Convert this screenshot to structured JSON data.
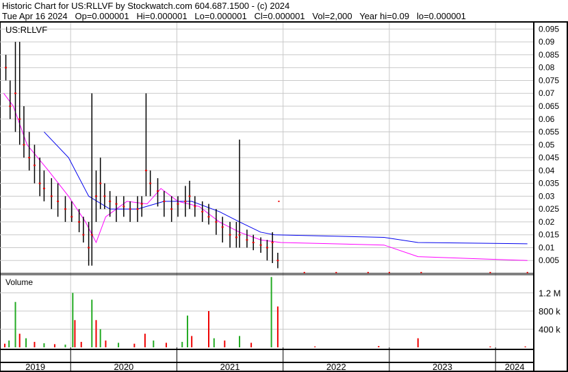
{
  "header": {
    "title": "Historic Chart for US:RLLVF by Stockwatch.com 604.687.1500 - (c) 2024",
    "quote": "Tue Apr 16 2024   Op=0.000001   Hi=0.000001   Lo=0.000001   Cl=0.000001   Vol=2,000   Year hi=0.09   lo=0.000001"
  },
  "price_panel_label": "US:RLLVF",
  "volume_panel_label": "Volume",
  "colors": {
    "up": "#22aa22",
    "down": "#ee0000",
    "ma_long": "#0000ee",
    "ma_short": "#ff00ff",
    "grid": "#c8c8c8"
  },
  "chart_data": {
    "type": "bar",
    "title": "Historic Chart for US:RLLVF",
    "x_range": [
      2019.335,
      2024.36
    ],
    "x_tick_labels": [
      "2019",
      "2020",
      "2021",
      "2022",
      "2023",
      "2024"
    ],
    "year_starts": [
      2020,
      2021,
      2022,
      2023,
      2024
    ],
    "price_ylim": [
      0,
      0.0975
    ],
    "price_ticks": [
      "0.005",
      "0.01",
      "0.015",
      "0.02",
      "0.025",
      "0.03",
      "0.035",
      "0.04",
      "0.045",
      "0.05",
      "0.055",
      "0.06",
      "0.065",
      "0.07",
      "0.075",
      "0.08",
      "0.085",
      "0.09",
      "0.095"
    ],
    "volume_ylim": [
      0,
      1600000
    ],
    "volume_ticks": [
      {
        "v": 400000,
        "label": "400 k"
      },
      {
        "v": 800000,
        "label": "800 k"
      },
      {
        "v": 1200000,
        "label": "1.2 M"
      }
    ],
    "price_bars": [
      {
        "t": 2019.39,
        "h": 0.085,
        "l": 0.075,
        "c": 0.08
      },
      {
        "t": 2019.43,
        "h": 0.075,
        "l": 0.06,
        "c": 0.065
      },
      {
        "t": 2019.48,
        "h": 0.09,
        "l": 0.055,
        "c": 0.07
      },
      {
        "t": 2019.52,
        "h": 0.09,
        "l": 0.05,
        "c": 0.06
      },
      {
        "t": 2019.56,
        "h": 0.065,
        "l": 0.045,
        "c": 0.05
      },
      {
        "t": 2019.61,
        "h": 0.055,
        "l": 0.04,
        "c": 0.045
      },
      {
        "t": 2019.66,
        "h": 0.05,
        "l": 0.035,
        "c": 0.042
      },
      {
        "t": 2019.71,
        "h": 0.045,
        "l": 0.03,
        "c": 0.035
      },
      {
        "t": 2019.75,
        "h": 0.04,
        "l": 0.028,
        "c": 0.033
      },
      {
        "t": 2019.82,
        "h": 0.037,
        "l": 0.025,
        "c": 0.03
      },
      {
        "t": 2019.88,
        "h": 0.035,
        "l": 0.022,
        "c": 0.028
      },
      {
        "t": 2019.95,
        "h": 0.03,
        "l": 0.02,
        "c": 0.025
      },
      {
        "t": 2020.01,
        "h": 0.028,
        "l": 0.02,
        "c": 0.022
      },
      {
        "t": 2020.08,
        "h": 0.025,
        "l": 0.016,
        "c": 0.02
      },
      {
        "t": 2020.12,
        "h": 0.022,
        "l": 0.012,
        "c": 0.015
      },
      {
        "t": 2020.17,
        "h": 0.02,
        "l": 0.003,
        "c": 0.01
      },
      {
        "t": 2020.2,
        "h": 0.07,
        "l": 0.003,
        "c": 0.015
      },
      {
        "t": 2020.24,
        "h": 0.04,
        "l": 0.02,
        "c": 0.03
      },
      {
        "t": 2020.28,
        "h": 0.045,
        "l": 0.025,
        "c": 0.035
      },
      {
        "t": 2020.32,
        "h": 0.035,
        "l": 0.025,
        "c": 0.03
      },
      {
        "t": 2020.37,
        "h": 0.032,
        "l": 0.022,
        "c": 0.028
      },
      {
        "t": 2020.43,
        "h": 0.03,
        "l": 0.02,
        "c": 0.027
      },
      {
        "t": 2020.5,
        "h": 0.03,
        "l": 0.022,
        "c": 0.026
      },
      {
        "t": 2020.56,
        "h": 0.028,
        "l": 0.02,
        "c": 0.025
      },
      {
        "t": 2020.63,
        "h": 0.03,
        "l": 0.02,
        "c": 0.025
      },
      {
        "t": 2020.67,
        "h": 0.03,
        "l": 0.022,
        "c": 0.027
      },
      {
        "t": 2020.71,
        "h": 0.07,
        "l": 0.03,
        "c": 0.04
      },
      {
        "t": 2020.75,
        "h": 0.04,
        "l": 0.03,
        "c": 0.035
      },
      {
        "t": 2020.82,
        "h": 0.037,
        "l": 0.026,
        "c": 0.032
      },
      {
        "t": 2020.88,
        "h": 0.032,
        "l": 0.022,
        "c": 0.028
      },
      {
        "t": 2020.95,
        "h": 0.03,
        "l": 0.02,
        "c": 0.025
      },
      {
        "t": 2021.01,
        "h": 0.03,
        "l": 0.022,
        "c": 0.027
      },
      {
        "t": 2021.08,
        "h": 0.034,
        "l": 0.022,
        "c": 0.028
      },
      {
        "t": 2021.12,
        "h": 0.036,
        "l": 0.025,
        "c": 0.03
      },
      {
        "t": 2021.17,
        "h": 0.03,
        "l": 0.022,
        "c": 0.026
      },
      {
        "t": 2021.24,
        "h": 0.028,
        "l": 0.02,
        "c": 0.024
      },
      {
        "t": 2021.3,
        "h": 0.027,
        "l": 0.019,
        "c": 0.022
      },
      {
        "t": 2021.37,
        "h": 0.025,
        "l": 0.015,
        "c": 0.02
      },
      {
        "t": 2021.43,
        "h": 0.022,
        "l": 0.012,
        "c": 0.018
      },
      {
        "t": 2021.5,
        "h": 0.02,
        "l": 0.01,
        "c": 0.015
      },
      {
        "t": 2021.56,
        "h": 0.02,
        "l": 0.01,
        "c": 0.014
      },
      {
        "t": 2021.59,
        "h": 0.052,
        "l": 0.01,
        "c": 0.015
      },
      {
        "t": 2021.66,
        "h": 0.017,
        "l": 0.01,
        "c": 0.013
      },
      {
        "t": 2021.72,
        "h": 0.015,
        "l": 0.009,
        "c": 0.012
      },
      {
        "t": 2021.79,
        "h": 0.014,
        "l": 0.008,
        "c": 0.011
      },
      {
        "t": 2021.85,
        "h": 0.013,
        "l": 0.005,
        "c": 0.01
      },
      {
        "t": 2021.9,
        "h": 0.016,
        "l": 0.004,
        "c": 0.012
      },
      {
        "t": 2021.95,
        "h": 0.008,
        "l": 0.002,
        "c": 0.005
      }
    ],
    "sparse_closes": [
      {
        "t": 2021.96,
        "c": 0.028
      },
      {
        "t": 2022.2,
        "c": 0.0003
      },
      {
        "t": 2022.5,
        "c": 0.0003
      },
      {
        "t": 2022.8,
        "c": 0.0003
      },
      {
        "t": 2023.0,
        "c": 0.0003
      },
      {
        "t": 2023.3,
        "c": 0.0003
      },
      {
        "t": 2023.95,
        "c": 0.0003
      },
      {
        "t": 2024.3,
        "c": 0.0003
      }
    ],
    "series": [
      {
        "name": "long moving average",
        "points": [
          [
            2019.75,
            0.055
          ],
          [
            2019.98,
            0.045
          ],
          [
            2020.17,
            0.03
          ],
          [
            2020.37,
            0.025
          ],
          [
            2020.63,
            0.025
          ],
          [
            2020.88,
            0.028
          ],
          [
            2021.14,
            0.028
          ],
          [
            2021.4,
            0.024
          ],
          [
            2021.59,
            0.02
          ],
          [
            2021.79,
            0.016
          ],
          [
            2021.92,
            0.015
          ],
          [
            2022.95,
            0.014
          ],
          [
            2023.27,
            0.012
          ],
          [
            2024.3,
            0.0115
          ]
        ]
      },
      {
        "name": "short moving average",
        "points": [
          [
            2019.37,
            0.07
          ],
          [
            2019.46,
            0.065
          ],
          [
            2019.59,
            0.05
          ],
          [
            2019.79,
            0.04
          ],
          [
            2019.98,
            0.03
          ],
          [
            2020.14,
            0.02
          ],
          [
            2020.24,
            0.012
          ],
          [
            2020.33,
            0.022
          ],
          [
            2020.53,
            0.028
          ],
          [
            2020.72,
            0.027
          ],
          [
            2020.85,
            0.033
          ],
          [
            2021.01,
            0.028
          ],
          [
            2021.21,
            0.026
          ],
          [
            2021.4,
            0.02
          ],
          [
            2021.59,
            0.016
          ],
          [
            2021.79,
            0.013
          ],
          [
            2021.98,
            0.012
          ],
          [
            2022.95,
            0.011
          ],
          [
            2023.27,
            0.0065
          ],
          [
            2024.3,
            0.005
          ]
        ]
      }
    ],
    "volume": [
      {
        "t": 2019.38,
        "v": 80000,
        "up": false
      },
      {
        "t": 2019.42,
        "v": 150000,
        "up": true
      },
      {
        "t": 2019.48,
        "v": 1000000,
        "up": true
      },
      {
        "t": 2019.52,
        "v": 300000,
        "up": false
      },
      {
        "t": 2019.58,
        "v": 200000,
        "up": true
      },
      {
        "t": 2019.66,
        "v": 120000,
        "up": false
      },
      {
        "t": 2019.75,
        "v": 90000,
        "up": true
      },
      {
        "t": 2019.85,
        "v": 70000,
        "up": false
      },
      {
        "t": 2019.95,
        "v": 60000,
        "up": true
      },
      {
        "t": 2020.02,
        "v": 1200000,
        "up": true
      },
      {
        "t": 2020.04,
        "v": 600000,
        "up": false
      },
      {
        "t": 2020.1,
        "v": 120000,
        "up": false
      },
      {
        "t": 2020.2,
        "v": 1050000,
        "up": true
      },
      {
        "t": 2020.24,
        "v": 600000,
        "up": false
      },
      {
        "t": 2020.28,
        "v": 400000,
        "up": true
      },
      {
        "t": 2020.33,
        "v": 150000,
        "up": false
      },
      {
        "t": 2020.45,
        "v": 100000,
        "up": true
      },
      {
        "t": 2020.6,
        "v": 80000,
        "up": false
      },
      {
        "t": 2020.7,
        "v": 300000,
        "up": false
      },
      {
        "t": 2020.78,
        "v": 150000,
        "up": true
      },
      {
        "t": 2020.9,
        "v": 100000,
        "up": false
      },
      {
        "t": 2021.05,
        "v": 120000,
        "up": true
      },
      {
        "t": 2021.1,
        "v": 700000,
        "up": true
      },
      {
        "t": 2021.14,
        "v": 250000,
        "up": false
      },
      {
        "t": 2021.3,
        "v": 800000,
        "up": false
      },
      {
        "t": 2021.35,
        "v": 200000,
        "up": true
      },
      {
        "t": 2021.45,
        "v": 150000,
        "up": false
      },
      {
        "t": 2021.59,
        "v": 250000,
        "up": true
      },
      {
        "t": 2021.7,
        "v": 100000,
        "up": false
      },
      {
        "t": 2021.89,
        "v": 1550000,
        "up": true
      },
      {
        "t": 2021.95,
        "v": 900000,
        "up": false
      },
      {
        "t": 2022.3,
        "v": 20000,
        "up": false
      },
      {
        "t": 2022.9,
        "v": 30000,
        "up": false
      },
      {
        "t": 2023.27,
        "v": 200000,
        "up": false
      },
      {
        "t": 2023.95,
        "v": 20000,
        "up": false
      },
      {
        "t": 2024.28,
        "v": 20000,
        "up": false
      }
    ]
  }
}
